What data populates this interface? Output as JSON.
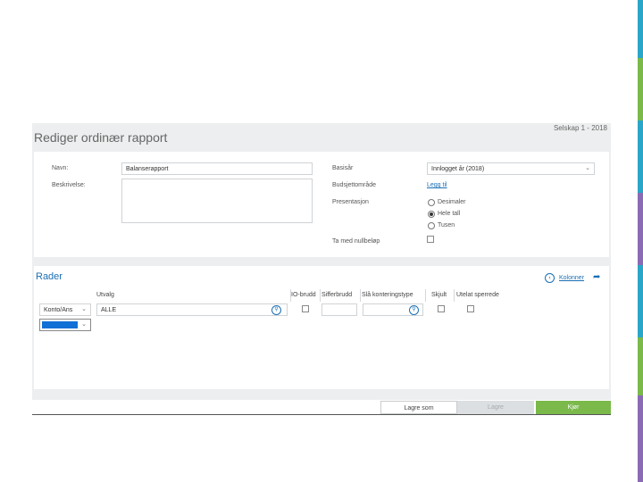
{
  "header": {
    "company": "Selskap 1 - 2018",
    "title": "Rediger ordinær rapport"
  },
  "form": {
    "name_label": "Navn:",
    "name_value": "Balanserapport",
    "description_label": "Beskrivelse:",
    "description_value": "",
    "basis_year_label": "Basisår",
    "basis_year_value": "Innlogget år (2018)",
    "budget_area_label": "Budsjettområde",
    "budget_area_link": "Legg til",
    "presentation_label": "Presentasjon",
    "presentation_options": [
      "Desimaler",
      "Hele tall",
      "Tusen"
    ],
    "presentation_selected": "Hele tall",
    "include_zero_label": "Ta med nullbeløp",
    "include_zero_checked": false
  },
  "rows": {
    "title": "Rader",
    "columns_link": "Kolonner",
    "headers": {
      "selection": "Utvalg",
      "io_break": "IO-brudd",
      "digit_break": "Sifferbrudd",
      "posting_type": "Slå konteringstype",
      "hide": "Skjult",
      "exclude_closed": "Utelat sperrede"
    },
    "row1": {
      "type": "Konto/Ans",
      "selection": "ALLE"
    },
    "row2": {
      "type": ""
    }
  },
  "footer": {
    "save_as": "Lagre som",
    "save": "Lagre",
    "run": "Kjør"
  },
  "colors": {
    "accent_blue": "#1a6fb5",
    "run_green": "#7ab94a",
    "selected_blue": "#1170d6"
  },
  "icons": {
    "select_arrow": "chevron-down-icon",
    "search": "search-icon",
    "back": "back-circle-icon",
    "forward": "arrow-right-icon"
  }
}
